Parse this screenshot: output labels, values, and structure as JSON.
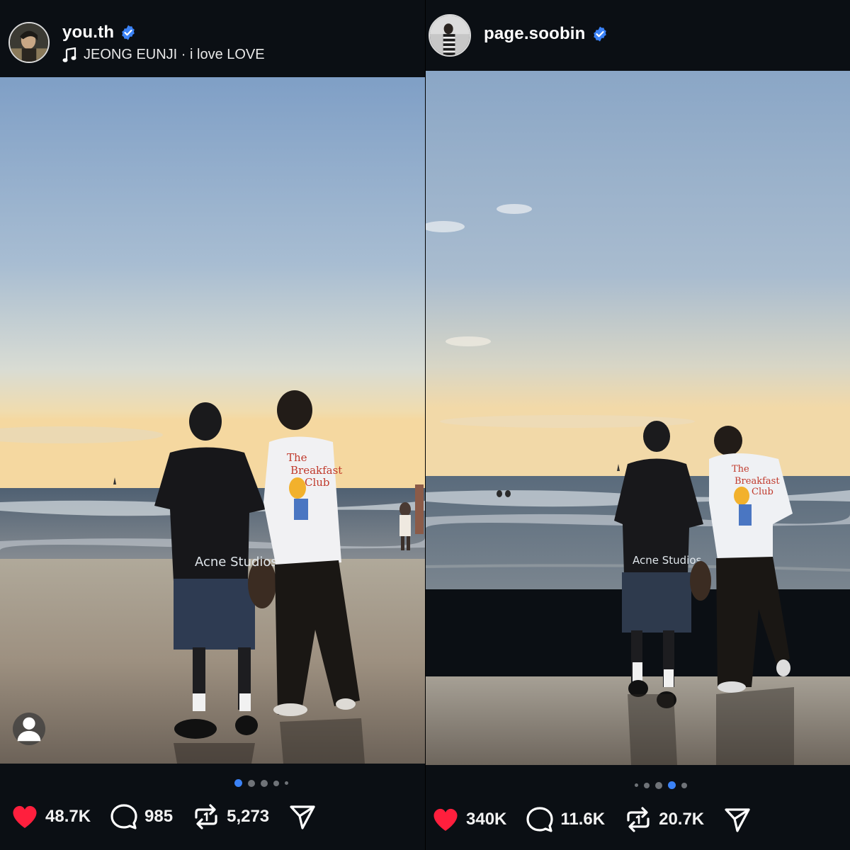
{
  "posts": [
    {
      "username": "you.th",
      "verified": true,
      "music": "JEONG EUNJI · i love LOVE",
      "stats": {
        "likes": "48.7K",
        "comments": "985",
        "reposts": "5,273"
      },
      "carousel": {
        "count": 5,
        "active": 1
      }
    },
    {
      "username": "page.soobin",
      "verified": true,
      "music": "",
      "stats": {
        "likes": "340K",
        "comments": "11.6K",
        "reposts": "20.7K"
      },
      "carousel": {
        "count": 5,
        "active": 4
      }
    }
  ],
  "icons": {
    "like": "heart-icon",
    "comment": "comment-icon",
    "repost": "repost-icon",
    "share": "share-icon",
    "verified": "verified-badge-icon",
    "music": "music-note-icon",
    "profile": "person-icon"
  },
  "colors": {
    "background": "#0b0f14",
    "heart": "#ff1f3d",
    "verified": "#3b82f6",
    "active_dot": "#3b82f6"
  }
}
